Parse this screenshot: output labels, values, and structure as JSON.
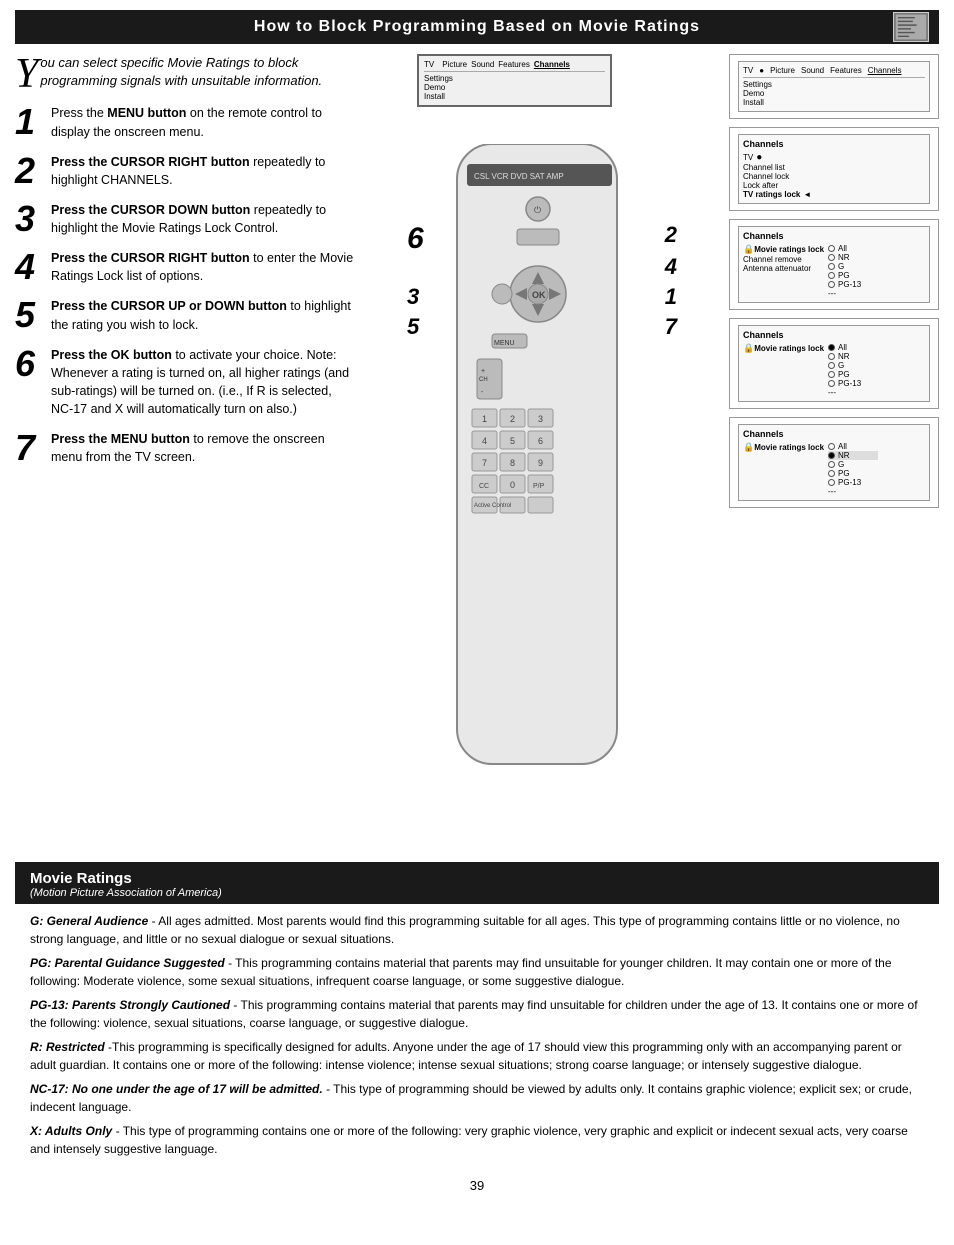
{
  "header": {
    "title": "How to Block Programming Based on Movie Ratings"
  },
  "intro": {
    "drop_cap": "Y",
    "text": "ou can select specific Movie Ratings to block programming signals with unsuitable information."
  },
  "steps": [
    {
      "number": "1",
      "text": "Press the ",
      "bold": "MENU button",
      "rest": " on the remote control to display the onscreen menu."
    },
    {
      "number": "2",
      "bold": "Press the CURSOR RIGHT button",
      "rest": " repeatedly to highlight CHANNELS."
    },
    {
      "number": "3",
      "bold": "Press the CURSOR DOWN button",
      "rest": " repeatedly to highlight the Movie Ratings Lock Control."
    },
    {
      "number": "4",
      "bold": "Press the CURSOR RIGHT button",
      "rest": " to enter the Movie Ratings Lock list of options."
    },
    {
      "number": "5",
      "bold": "Press the CURSOR UP or DOWN button",
      "rest": " to highlight the rating you wish to lock."
    },
    {
      "number": "6",
      "bold": "Press the OK button",
      "rest": " to activate your choice. Note: Whenever a rating is turned on, all higher ratings (and sub-ratings) will be turned on. (i.e., If R is selected, NC-17 and X will automatically turn on also.)"
    },
    {
      "number": "7",
      "bold": "Press the MENU button",
      "rest": " to remove the onscreen menu from the TV screen."
    }
  ],
  "screens": [
    {
      "id": "screen1",
      "label": "TV",
      "menu_items": [
        "Picture",
        "Sound",
        "Features",
        "Channels"
      ],
      "sidebar": [
        "Settings",
        "Demo",
        "Install"
      ]
    },
    {
      "id": "screen2",
      "label": "Channels",
      "items": [
        {
          "text": "TV",
          "selected": false,
          "arrow": true
        },
        {
          "text": "Channel list",
          "selected": false
        },
        {
          "text": "Channel lock",
          "selected": false
        },
        {
          "text": "Lock after",
          "selected": false
        },
        {
          "text": "TV ratings lock",
          "selected": true,
          "arrow": true
        }
      ]
    },
    {
      "id": "screen3",
      "label": "Channels",
      "items": [
        {
          "text": "Movie ratings lock",
          "selected": true,
          "lock": true
        },
        {
          "text": "Channel remove",
          "selected": false
        },
        {
          "text": "Antenna attenuator",
          "selected": false
        }
      ],
      "ratings": [
        "All",
        "NR",
        "G",
        "PG",
        "PG-13",
        "---"
      ]
    },
    {
      "id": "screen4",
      "label": "Channels",
      "items": [
        {
          "text": "Movie ratings lock",
          "selected": true,
          "lock": true
        }
      ],
      "ratings": [
        "All",
        "NR",
        "G",
        "PG",
        "PG-13",
        "---"
      ],
      "selected_rating": "All"
    },
    {
      "id": "screen5",
      "label": "Channels",
      "items": [
        {
          "text": "Movie ratings lock",
          "selected": true,
          "lock": true
        }
      ],
      "ratings": [
        "All",
        "NR",
        "G",
        "PG",
        "PG-13",
        "---"
      ],
      "selected_rating": "NR"
    }
  ],
  "footer": {
    "title": "Movie Ratings",
    "subtitle": "(Motion Picture Association of America)",
    "ratings": [
      {
        "label": "G: General Audience",
        "text": " - All ages admitted. Most parents would find this programming suitable for all ages. This type of programming contains little or no violence, no strong language, and little or no sexual dialogue or sexual situations."
      },
      {
        "label": "PG: Parental Guidance Suggested",
        "text": " - This programming contains material that parents may find unsuitable for younger children. It may contain one or more of the following: Moderate violence, some sexual situations, infrequent coarse language, or some suggestive dialogue."
      },
      {
        "label": "PG-13: Parents Strongly Cautioned",
        "text": " - This programming contains material that parents may find unsuitable for children under the age of 13. It contains one or more of the following: violence, sexual situations, coarse language, or suggestive dialogue."
      },
      {
        "label": "R: Restricted",
        "text": " -This programming is specifically designed for adults. Anyone under the age of 17 should view this programming only with an accompanying parent or adult guardian. It contains one or more of the following: intense violence; intense sexual situations; strong coarse language; or intensely suggestive dialogue."
      },
      {
        "label": "NC-17: No one under the age of 17 will be admitted.",
        "text": " - This type of programming should be viewed by adults only. It contains graphic violence; explicit sex; or crude, indecent language."
      },
      {
        "label": "X: Adults Only",
        "text": " - This type of programming contains one or more of the following: very graphic violence, very graphic and explicit or indecent sexual acts, very coarse and intensely suggestive language."
      }
    ]
  },
  "page_number": "39"
}
